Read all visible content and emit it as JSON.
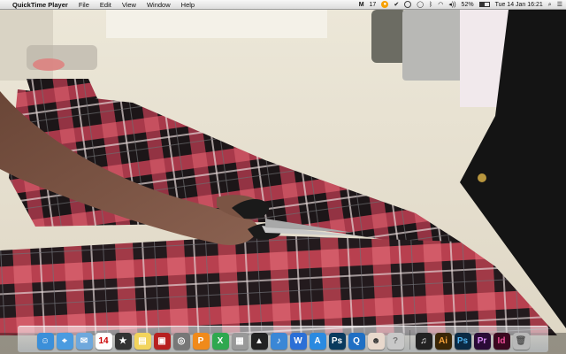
{
  "menubar": {
    "app_name": "QuickTime Player",
    "menus": [
      "File",
      "Edit",
      "View",
      "Window",
      "Help"
    ],
    "status": {
      "adobe_label": "17",
      "battery_percent": "52%",
      "datetime": "Tue 14 Jan  16:21"
    }
  },
  "video": {
    "description_colors": {
      "carpet": "#e8e2d2",
      "fabric_red": "#b03a4a",
      "fabric_black": "#1c1618",
      "skin": "#7a5443"
    }
  },
  "dock": {
    "items": [
      {
        "name": "finder-icon",
        "glyph": "☺",
        "color": "#3b8fd9"
      },
      {
        "name": "safari-icon",
        "glyph": "⌖",
        "color": "#4a9be0"
      },
      {
        "name": "mail-icon",
        "glyph": "✉",
        "color": "#6fa8dc"
      },
      {
        "name": "calendar-icon",
        "glyph": "14",
        "color": "#ffffff",
        "text": "#c00"
      },
      {
        "name": "imovie-icon",
        "glyph": "★",
        "color": "#333333"
      },
      {
        "name": "stickies-icon",
        "glyph": "▤",
        "color": "#f2d45c"
      },
      {
        "name": "photobooth-icon",
        "glyph": "▣",
        "color": "#b72020"
      },
      {
        "name": "image-capture-icon",
        "glyph": "◎",
        "color": "#777777"
      },
      {
        "name": "pages-icon",
        "glyph": "P",
        "color": "#f08a1a"
      },
      {
        "name": "numbers-icon",
        "glyph": "X",
        "color": "#2fa84f"
      },
      {
        "name": "calculator-icon",
        "glyph": "▦",
        "color": "#999999"
      },
      {
        "name": "final-cut-icon",
        "glyph": "▲",
        "color": "#222222"
      },
      {
        "name": "itunes-icon",
        "glyph": "♪",
        "color": "#3a87d6"
      },
      {
        "name": "word-icon",
        "glyph": "W",
        "color": "#2b6fd6"
      },
      {
        "name": "app-store-icon",
        "glyph": "A",
        "color": "#2a8ae0"
      },
      {
        "name": "photoshop-icon",
        "glyph": "Ps",
        "color": "#0a3a5e"
      },
      {
        "name": "quicktime-icon",
        "glyph": "Q",
        "color": "#1f6fc4"
      },
      {
        "name": "photo-thumbnail-icon",
        "glyph": "☻",
        "color": "#e8d8cc",
        "text": "#333"
      },
      {
        "name": "help-icon",
        "glyph": "?",
        "color": "#c8c8c8",
        "text": "#777"
      },
      {
        "name": "sep",
        "glyph": "",
        "color": ""
      },
      {
        "name": "music-app-icon",
        "glyph": "♫",
        "color": "#222222"
      },
      {
        "name": "illustrator-icon",
        "glyph": "Ai",
        "color": "#3a2606",
        "text": "#f7a23b"
      },
      {
        "name": "photoshop-alt-icon",
        "glyph": "Ps",
        "color": "#0b2a44",
        "text": "#4fb3f0"
      },
      {
        "name": "premiere-icon",
        "glyph": "Pr",
        "color": "#2a0b36",
        "text": "#d98cf5"
      },
      {
        "name": "indesign-icon",
        "glyph": "Id",
        "color": "#3a0820",
        "text": "#f04f9a"
      },
      {
        "name": "trash-icon",
        "glyph": "🗑",
        "color": "#b8b8b8",
        "text": "#555"
      }
    ]
  }
}
